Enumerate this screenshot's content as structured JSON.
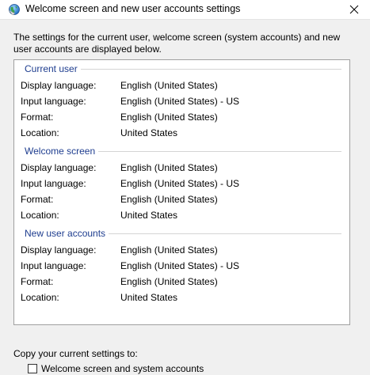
{
  "window": {
    "title": "Welcome screen and new user accounts settings",
    "icon": "globe-icon",
    "close_icon": "close-icon"
  },
  "intro_text": "The settings for the current user, welcome screen (system accounts) and new user accounts are displayed below.",
  "groups": [
    {
      "header": "Current user",
      "rows": [
        {
          "label": "Display language:",
          "value": "English (United States)"
        },
        {
          "label": "Input language:",
          "value": "English (United States) - US"
        },
        {
          "label": "Format:",
          "value": "English (United States)"
        },
        {
          "label": "Location:",
          "value": "United States"
        }
      ]
    },
    {
      "header": "Welcome screen",
      "rows": [
        {
          "label": "Display language:",
          "value": "English (United States)"
        },
        {
          "label": "Input language:",
          "value": "English (United States) - US"
        },
        {
          "label": "Format:",
          "value": "English (United States)"
        },
        {
          "label": "Location:",
          "value": "United States"
        }
      ]
    },
    {
      "header": "New user accounts",
      "rows": [
        {
          "label": "Display language:",
          "value": "English (United States)"
        },
        {
          "label": "Input language:",
          "value": "English (United States) - US"
        },
        {
          "label": "Format:",
          "value": "English (United States)"
        },
        {
          "label": "Location:",
          "value": "United States"
        }
      ]
    }
  ],
  "copy_section": {
    "label": "Copy your current settings to:",
    "checkbox_label": "Welcome screen and system accounts"
  },
  "colors": {
    "group_header": "#1e3d8f",
    "background": "#f0f0f0"
  }
}
